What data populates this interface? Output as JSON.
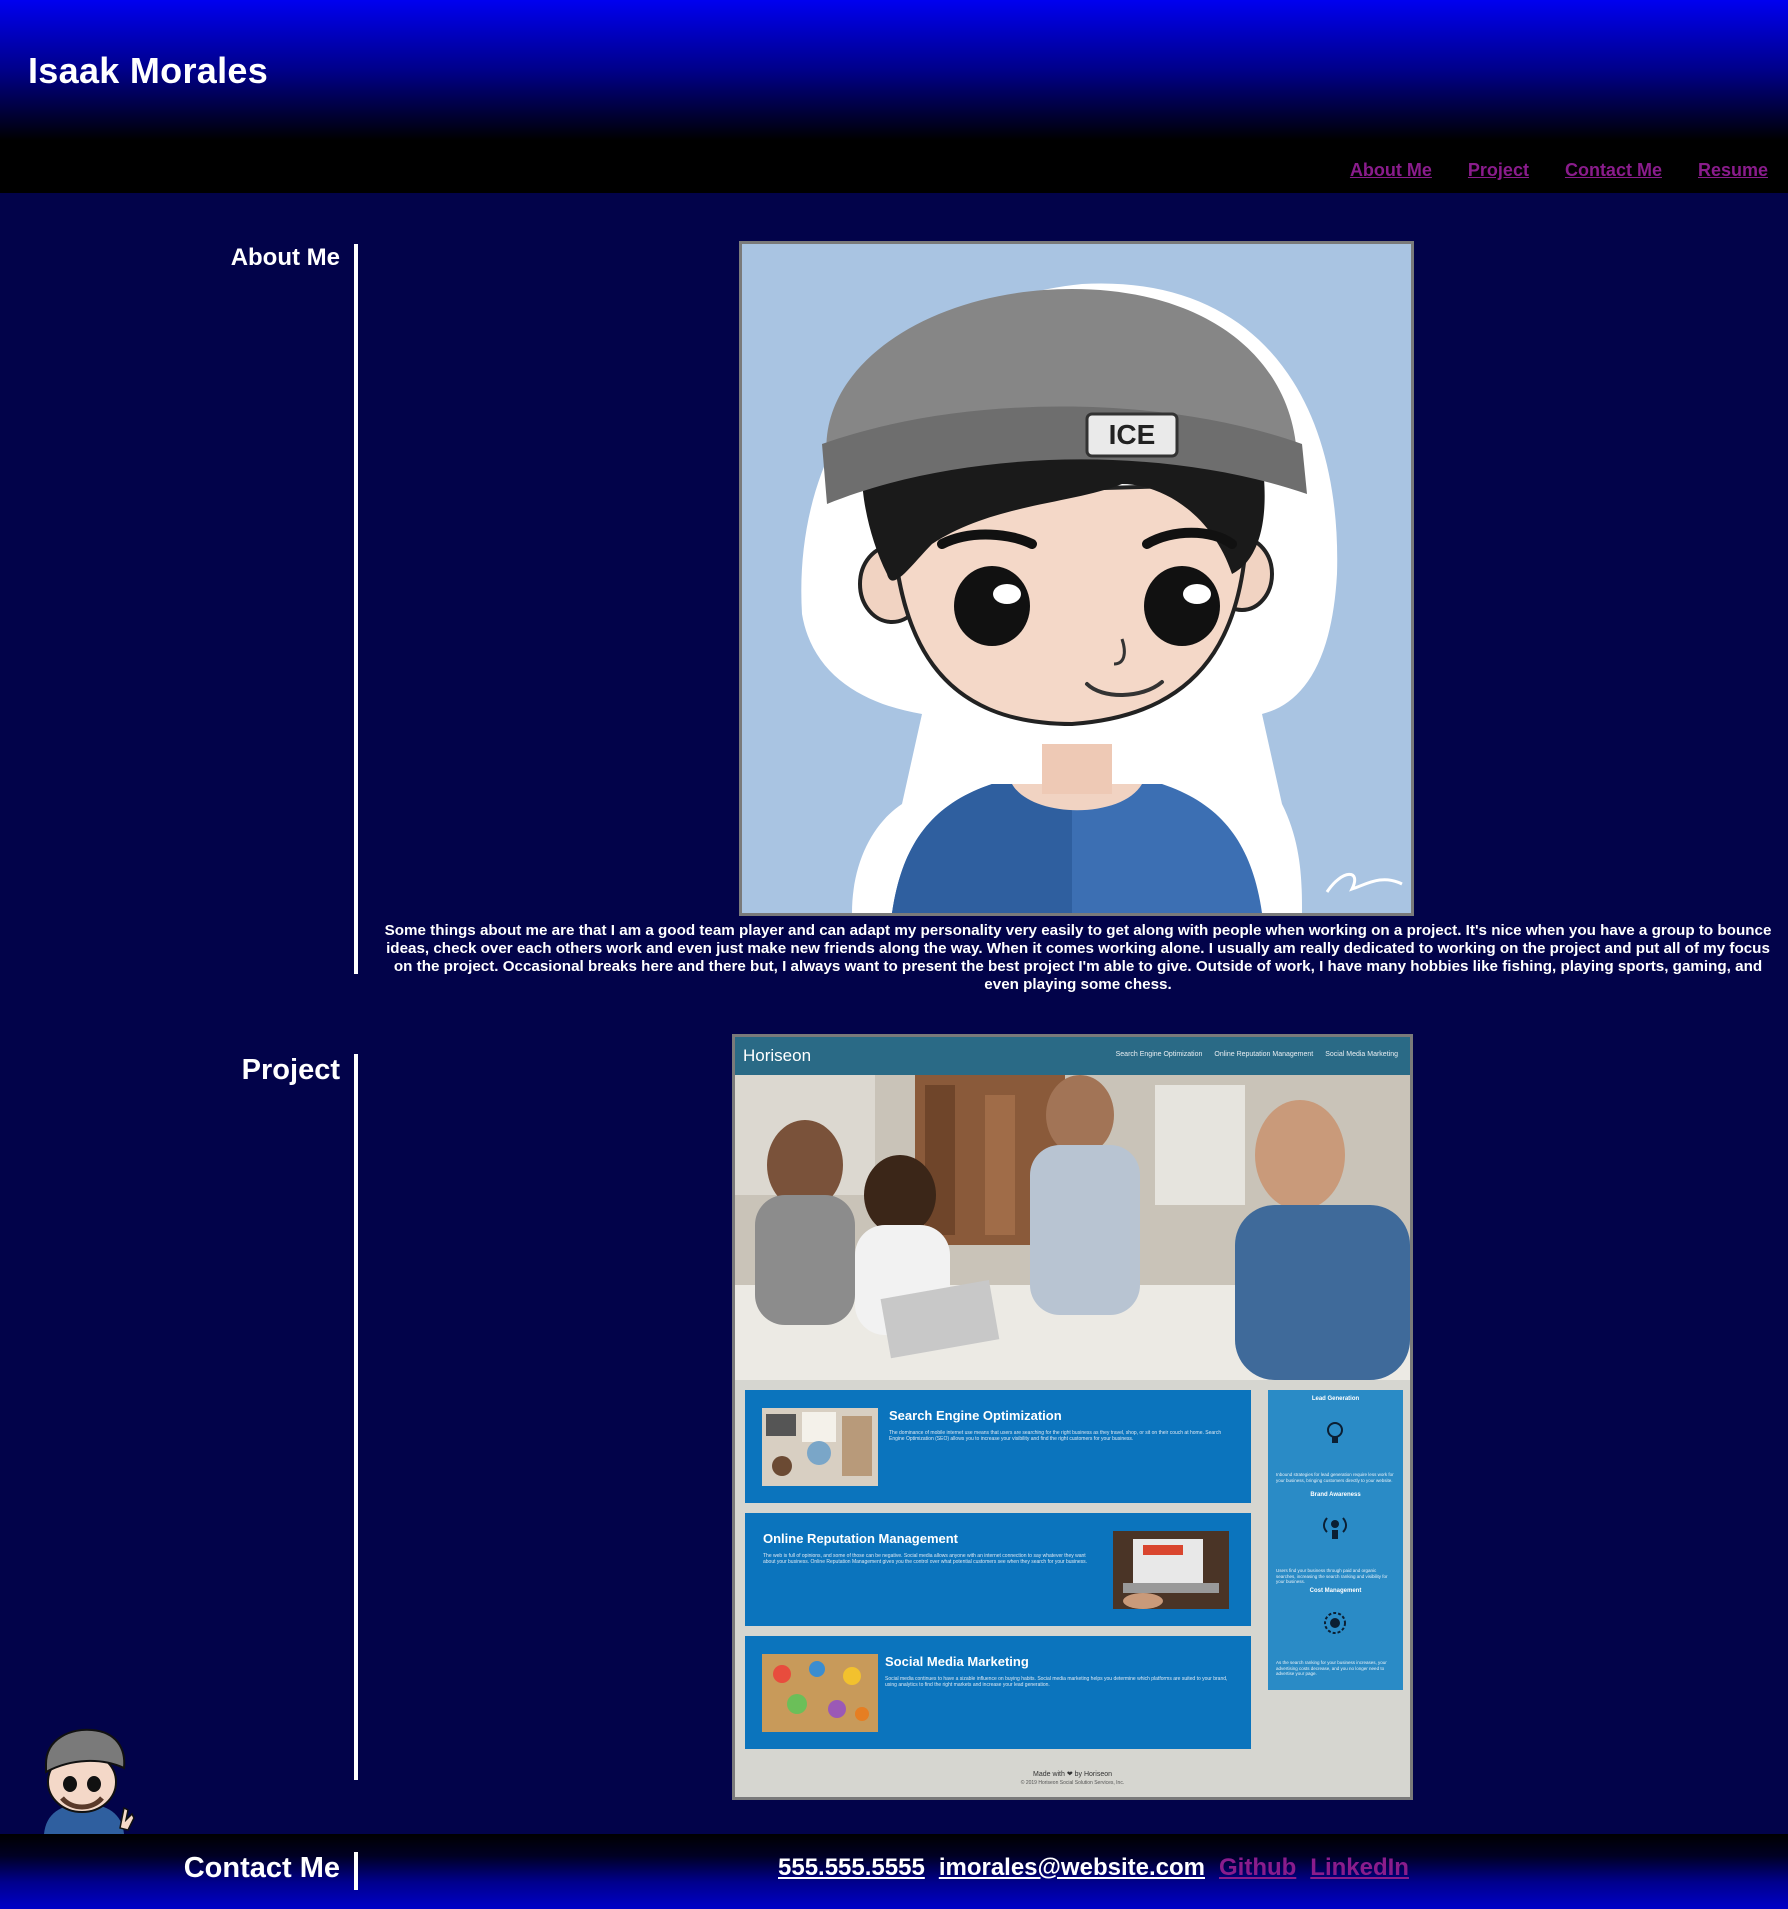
{
  "header": {
    "title": "Isaak Morales",
    "nav": [
      "About Me",
      "Project",
      "Contact Me",
      "Resume"
    ]
  },
  "about": {
    "heading": "About Me",
    "portrait_hat_text": "ICE",
    "text": "Some things about me are that I am a good team player and can adapt my personality very easily to get along with people when working on a project. It's nice when you have a group to bounce ideas, check over each others work and even just make new friends along the way. When it comes working alone. I usually am really dedicated to working on the project and put all of my focus on the project. Occasional breaks here and there but, I always want to present the best project I'm able to give. Outside of work, I have many hobbies like fishing, playing sports, gaming, and even playing some chess."
  },
  "project": {
    "heading": "Project",
    "screenshot": {
      "brand": "Horiseon",
      "nav": [
        "Search Engine Optimization",
        "Online Reputation Management",
        "Social Media Marketing"
      ],
      "cards": [
        {
          "title": "Search Engine Optimization",
          "body": "The dominance of mobile internet use means that users are searching for the right business as they travel, shop, or sit on their couch at home. Search Engine Optimization (SEO) allows you to increase your visibility and find the right customers for your business."
        },
        {
          "title": "Online Reputation Management",
          "body": "The web is full of opinions, and some of those can be negative. Social media allows anyone with an internet connection to say whatever they want about your business. Online Reputation Management gives you the control over what potential customers see when they search for your business."
        },
        {
          "title": "Social Media Marketing",
          "body": "Social media continues to have a sizable influence on buying habits. Social media marketing helps you determine which platforms are suited to your brand, using analytics to find the right markets and increase your lead generation."
        }
      ],
      "side": [
        {
          "title": "Lead Generation",
          "body": "Inbound strategies for lead generation require less work for your business, bringing customers directly to your website."
        },
        {
          "title": "Brand Awareness",
          "body": "Users find your business through paid and organic searches, increasing the search ranking and visibility for your business."
        },
        {
          "title": "Cost Management",
          "body": "As the search ranking for your business increases, your advertising costs decrease, and you no longer need to advertise your page."
        }
      ],
      "footer": "Made with ❤ by Horiseon",
      "footer_sub": "© 2019 Horiseon Social Solution Services, Inc."
    }
  },
  "contact": {
    "heading": "Contact Me",
    "phone": "555.555.5555",
    "email": "imorales@website.com",
    "github": "Github",
    "linkedin": "LinkedIn"
  },
  "colors": {
    "background": "#02034a",
    "link_visited": "#8a1c8c",
    "header_gradient_top": "#0000f0"
  }
}
